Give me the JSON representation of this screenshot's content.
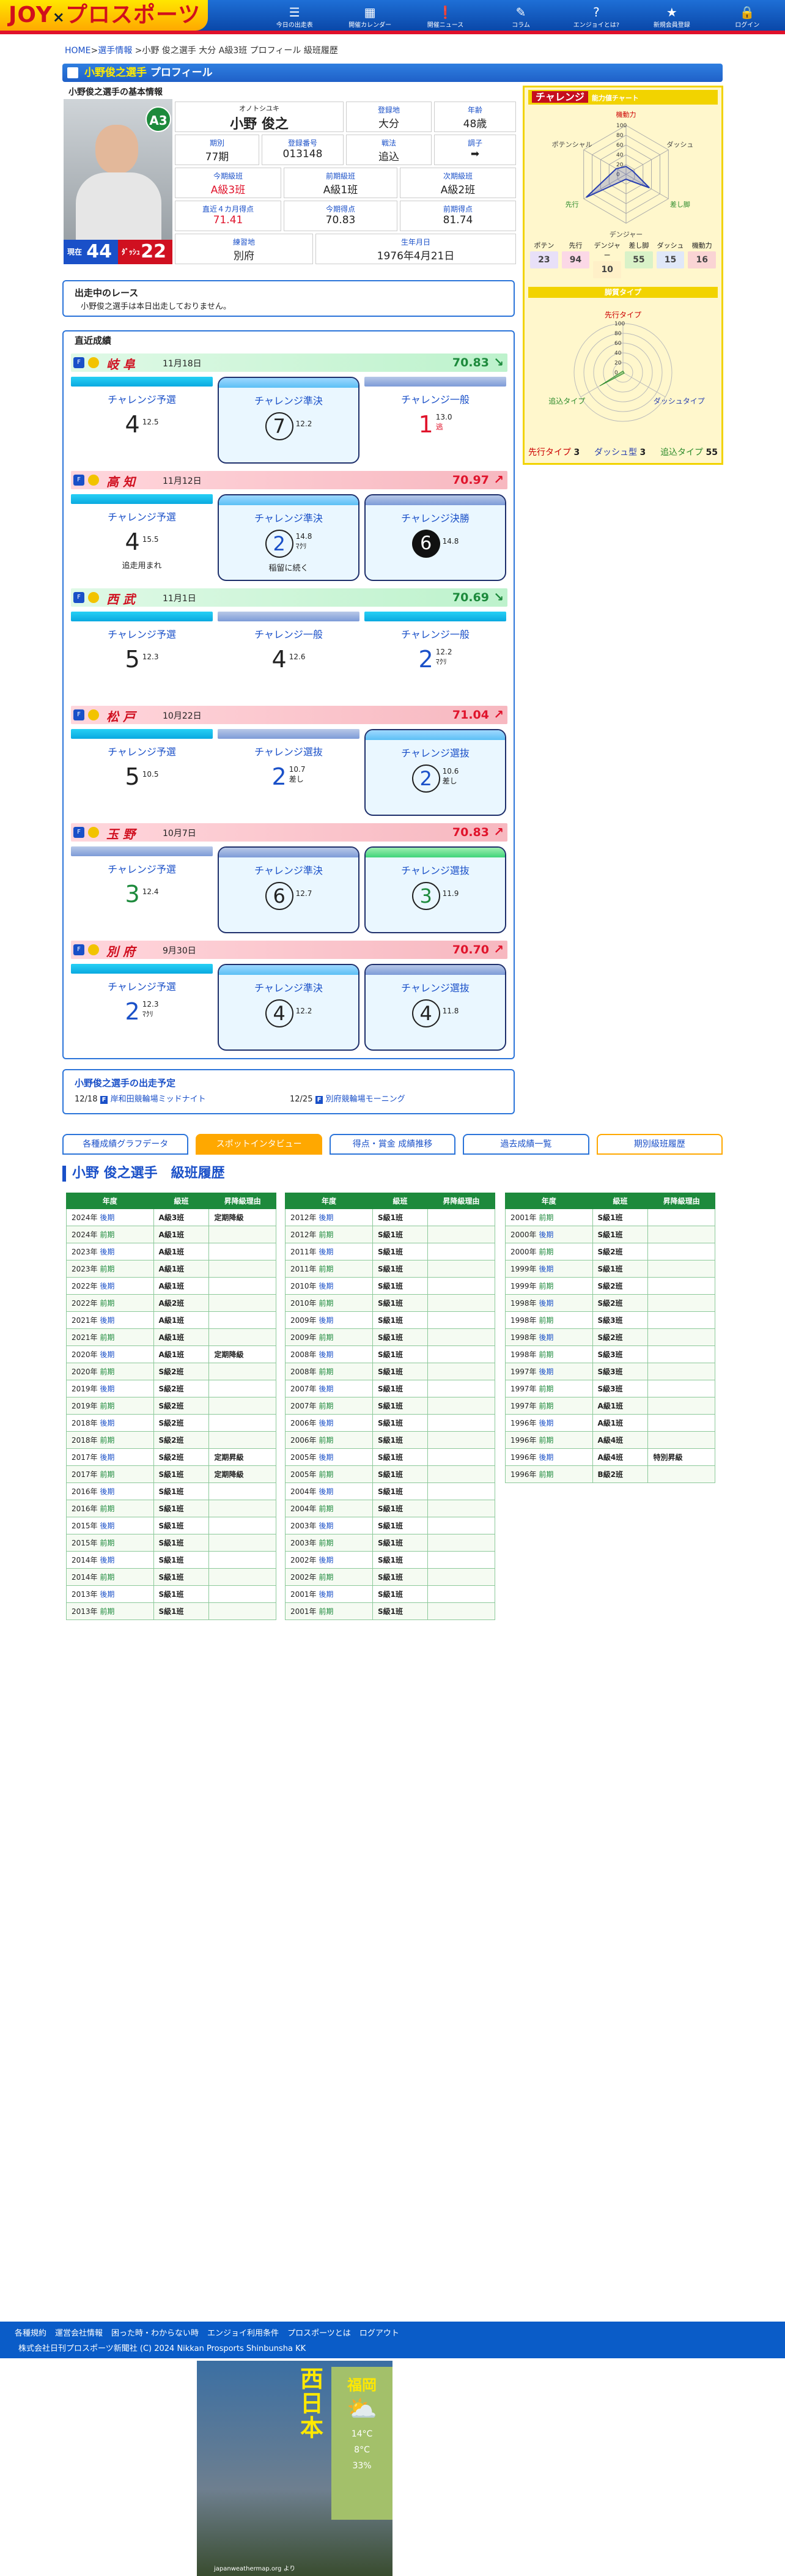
{
  "header": {
    "logo_a": "JOY",
    "logo_x": "×",
    "logo_b": "プロスポーツ",
    "nav": [
      {
        "icon": "newspaper-icon",
        "label": "今日の出走表",
        "g": "☰"
      },
      {
        "icon": "calendar-icon",
        "label": "開催カレンダー",
        "g": "▦"
      },
      {
        "icon": "alert-icon",
        "label": "開催ニュース",
        "g": "❗"
      },
      {
        "icon": "runner-icon",
        "label": "コラム",
        "g": "✎"
      },
      {
        "icon": "question-icon",
        "label": "エンジョイとは?",
        "g": "?"
      },
      {
        "icon": "member-icon",
        "label": "新規会員登録",
        "g": "★"
      },
      {
        "icon": "lock-icon",
        "label": "ログイン",
        "g": "🔒"
      }
    ]
  },
  "breadcrumb": {
    "home": "HOME",
    "sep": ">",
    "item": "選手情報",
    "rest": " >小野 俊之選手 大分 A級3班 プロフィール 級班履歴"
  },
  "title": {
    "name": "小野俊之選手",
    "suffix": "プロフィール"
  },
  "basic": {
    "heading": "小野俊之選手の基本情報",
    "rank_badge": "A3",
    "num1_label": "現在",
    "num1": "44",
    "num2_label": "ﾀﾞｯｼｭ",
    "num2": "22",
    "kana": "オノトシユキ",
    "name": "小野 俊之",
    "cells": [
      {
        "k": "登録地",
        "v": "大分"
      },
      {
        "k": "年齢",
        "v": "48歳"
      },
      {
        "k": "期別",
        "v": "77期"
      },
      {
        "k": "登録番号",
        "v": "013148"
      },
      {
        "k": "戦法",
        "v": "追込"
      },
      {
        "k": "調子",
        "v": "➡"
      },
      {
        "k": "今期級班",
        "v": "A級3班",
        "red": true
      },
      {
        "k": "前期級班",
        "v": "A級1班"
      },
      {
        "k": "次期級班",
        "v": "A級2班"
      },
      {
        "k": "直近４カ月得点",
        "v": "71.41",
        "red": true
      },
      {
        "k": "今期得点",
        "v": "70.83"
      },
      {
        "k": "前期得点",
        "v": "81.74"
      },
      {
        "k": "練習地",
        "v": "別府"
      },
      {
        "k": "生年月日",
        "v": "1976年4月21日"
      }
    ]
  },
  "challenge": {
    "tag": "チャレンジ",
    "label": "能力値チャート",
    "axes": [
      "機動力",
      "ダッシュ",
      "差し脚",
      "デンジャー",
      "先行",
      "ポテンシャル"
    ],
    "ticks": [
      "100",
      "80",
      "60",
      "40",
      "20",
      "0"
    ],
    "points": [
      {
        "k": "ポテン",
        "v": "23",
        "c": "#e8e0f8"
      },
      {
        "k": "先行",
        "v": "94",
        "c": "#fbd8e6"
      },
      {
        "k": "デンジャー",
        "v": "10",
        "c": "#fff0c8"
      },
      {
        "k": "差し脚",
        "v": "55",
        "c": "#d9f2c8"
      },
      {
        "k": "ダッシュ",
        "v": "15",
        "c": "#e0e8f8"
      },
      {
        "k": "機動力",
        "v": "16",
        "c": "#fad4d4"
      }
    ],
    "type_header": "脚質タイプ",
    "type_axes": [
      "先行タイプ",
      "ダッシュタイプ",
      "追込タイプ"
    ],
    "types": [
      {
        "label": "先行タイプ",
        "val": "3"
      },
      {
        "label": "ダッシュ型",
        "val": "3"
      },
      {
        "label": "追込タイプ",
        "val": "55"
      }
    ]
  },
  "race": {
    "title": "出走中のレース",
    "text": "小野俊之選手は本日出走しておりません。"
  },
  "recent": {
    "title": "直近成績",
    "rows": [
      {
        "c": "g",
        "venue": "岐 阜",
        "date": "11月18日",
        "score": "70.83",
        "arrow": "↘",
        "cards": [
          {
            "cap": "c1",
            "name": "チャレンジ予選",
            "pos": "4",
            "tm": "12.5"
          },
          {
            "cap": "c2",
            "name": "チャレンジ準決",
            "pos": "7",
            "tm": "12.2",
            "hl": true,
            "circ": true
          },
          {
            "cap": "c3",
            "name": "チャレンジ一般",
            "pos": "1",
            "tm": "13.0",
            "sub": "逃",
            "red": true
          }
        ]
      },
      {
        "c": "r",
        "venue": "高 知",
        "date": "11月12日",
        "score": "70.97",
        "arrow": "↗",
        "cards": [
          {
            "cap": "c1",
            "name": "チャレンジ予選",
            "pos": "4",
            "tm": "15.5",
            "note": "追走用まれ"
          },
          {
            "cap": "c2",
            "name": "チャレンジ準決",
            "pos": "2",
            "tm": "14.8",
            "sub": "ﾏｸﾘ",
            "note": "稲留に続く",
            "hl": true,
            "circ": true,
            "blue": true
          },
          {
            "cap": "c3",
            "name": "チャレンジ決勝",
            "pos": "6",
            "tm": "14.8",
            "hl": true,
            "blk": true
          }
        ]
      },
      {
        "c": "g",
        "venue": "西 武",
        "date": "11月1日",
        "score": "70.69",
        "arrow": "↘",
        "cards": [
          {
            "cap": "c1",
            "name": "チャレンジ予選",
            "pos": "5",
            "tm": "12.3"
          },
          {
            "cap": "c3",
            "name": "チャレンジ一般",
            "pos": "4",
            "tm": "12.6"
          },
          {
            "cap": "c1",
            "name": "チャレンジ一般",
            "pos": "2",
            "tm": "12.2",
            "sub": "ﾏｸﾘ",
            "blue": true
          }
        ]
      },
      {
        "c": "r",
        "venue": "松 戸",
        "date": "10月22日",
        "score": "71.04",
        "arrow": "↗",
        "cards": [
          {
            "cap": "c1",
            "name": "チャレンジ予選",
            "pos": "5",
            "tm": "10.5"
          },
          {
            "cap": "c3",
            "name": "チャレンジ選抜",
            "pos": "2",
            "tm": "10.7",
            "sub": "差し",
            "blue": true
          },
          {
            "cap": "c2",
            "name": "チャレンジ選抜",
            "pos": "2",
            "tm": "10.6",
            "sub": "差し",
            "hl": true,
            "circ": true,
            "blue": true
          }
        ]
      },
      {
        "c": "r",
        "venue": "玉 野",
        "date": "10月7日",
        "score": "70.83",
        "arrow": "↗",
        "cards": [
          {
            "cap": "c3",
            "name": "チャレンジ予選",
            "pos": "3",
            "tm": "12.4",
            "grn": true
          },
          {
            "cap": "c3",
            "name": "チャレンジ準決",
            "pos": "6",
            "tm": "12.7",
            "hl": true,
            "circ": true
          },
          {
            "cap": "c4",
            "name": "チャレンジ選抜",
            "pos": "3",
            "tm": "11.9",
            "hl": true,
            "circ": true,
            "grn": true
          }
        ]
      },
      {
        "c": "r",
        "venue": "別 府",
        "date": "9月30日",
        "score": "70.70",
        "arrow": "↗",
        "cards": [
          {
            "cap": "c1",
            "name": "チャレンジ予選",
            "pos": "2",
            "tm": "12.3",
            "sub": "ﾏｸﾘ",
            "blue": true
          },
          {
            "cap": "c2",
            "name": "チャレンジ準決",
            "pos": "4",
            "tm": "12.2",
            "hl": true,
            "circ": true
          },
          {
            "cap": "c3",
            "name": "チャレンジ選抜",
            "pos": "4",
            "tm": "11.8",
            "hl": true,
            "circ": true
          }
        ]
      }
    ]
  },
  "schedule": {
    "title": "小野俊之選手の出走予定",
    "e1_date": "12/18",
    "e1_text": "岸和田競輪場ミッドナイト",
    "e2_date": "12/25",
    "e2_text": "別府競輪場モーニング"
  },
  "tabs": [
    "各種成績グラフデータ",
    "スポットインタビュー",
    "得点・賞金 成績推移",
    "過去成績一覧",
    "期別級班履歴"
  ],
  "history": {
    "title": "小野 俊之選手　級班履歴",
    "cols": [
      "年度",
      "級班",
      "昇降級理由"
    ],
    "t1": [
      [
        "2024年",
        "後期",
        "A級3班",
        "定期降級"
      ],
      [
        "2024年",
        "前期",
        "A級1班",
        ""
      ],
      [
        "2023年",
        "後期",
        "A級1班",
        ""
      ],
      [
        "2023年",
        "前期",
        "A級1班",
        ""
      ],
      [
        "2022年",
        "後期",
        "A級1班",
        ""
      ],
      [
        "2022年",
        "前期",
        "A級2班",
        ""
      ],
      [
        "2021年",
        "後期",
        "A級1班",
        ""
      ],
      [
        "2021年",
        "前期",
        "A級1班",
        ""
      ],
      [
        "2020年",
        "後期",
        "A級1班",
        "定期降級"
      ],
      [
        "2020年",
        "前期",
        "S級2班",
        ""
      ],
      [
        "2019年",
        "後期",
        "S級2班",
        ""
      ],
      [
        "2019年",
        "前期",
        "S級2班",
        ""
      ],
      [
        "2018年",
        "後期",
        "S級2班",
        ""
      ],
      [
        "2018年",
        "前期",
        "S級2班",
        ""
      ],
      [
        "2017年",
        "後期",
        "S級2班",
        "定期昇級"
      ],
      [
        "2017年",
        "前期",
        "S級1班",
        "定期降級"
      ],
      [
        "2016年",
        "後期",
        "S級1班",
        ""
      ],
      [
        "2016年",
        "前期",
        "S級1班",
        ""
      ],
      [
        "2015年",
        "後期",
        "S級1班",
        ""
      ],
      [
        "2015年",
        "前期",
        "S級1班",
        ""
      ],
      [
        "2014年",
        "後期",
        "S級1班",
        ""
      ],
      [
        "2014年",
        "前期",
        "S級1班",
        ""
      ],
      [
        "2013年",
        "後期",
        "S級1班",
        ""
      ],
      [
        "2013年",
        "前期",
        "S級1班",
        ""
      ]
    ],
    "t2": [
      [
        "2012年",
        "後期",
        "S級1班",
        ""
      ],
      [
        "2012年",
        "前期",
        "S級1班",
        ""
      ],
      [
        "2011年",
        "後期",
        "S級1班",
        ""
      ],
      [
        "2011年",
        "前期",
        "S級1班",
        ""
      ],
      [
        "2010年",
        "後期",
        "S級1班",
        ""
      ],
      [
        "2010年",
        "前期",
        "S級1班",
        ""
      ],
      [
        "2009年",
        "後期",
        "S級1班",
        ""
      ],
      [
        "2009年",
        "前期",
        "S級1班",
        ""
      ],
      [
        "2008年",
        "後期",
        "S級1班",
        ""
      ],
      [
        "2008年",
        "前期",
        "S級1班",
        ""
      ],
      [
        "2007年",
        "後期",
        "S級1班",
        ""
      ],
      [
        "2007年",
        "前期",
        "S級1班",
        ""
      ],
      [
        "2006年",
        "後期",
        "S級1班",
        ""
      ],
      [
        "2006年",
        "前期",
        "S級1班",
        ""
      ],
      [
        "2005年",
        "後期",
        "S級1班",
        ""
      ],
      [
        "2005年",
        "前期",
        "S級1班",
        ""
      ],
      [
        "2004年",
        "後期",
        "S級1班",
        ""
      ],
      [
        "2004年",
        "前期",
        "S級1班",
        ""
      ],
      [
        "2003年",
        "後期",
        "S級1班",
        ""
      ],
      [
        "2003年",
        "前期",
        "S級1班",
        ""
      ],
      [
        "2002年",
        "後期",
        "S級1班",
        ""
      ],
      [
        "2002年",
        "前期",
        "S級1班",
        ""
      ],
      [
        "2001年",
        "後期",
        "S級1班",
        ""
      ],
      [
        "2001年",
        "前期",
        "S級1班",
        ""
      ]
    ],
    "t3": [
      [
        "2001年",
        "前期",
        "S級1班",
        ""
      ],
      [
        "2000年",
        "後期",
        "S級1班",
        ""
      ],
      [
        "2000年",
        "前期",
        "S級2班",
        ""
      ],
      [
        "1999年",
        "後期",
        "S級1班",
        ""
      ],
      [
        "1999年",
        "前期",
        "S級2班",
        ""
      ],
      [
        "1998年",
        "後期",
        "S級2班",
        ""
      ],
      [
        "1998年",
        "前期",
        "S級3班",
        ""
      ],
      [
        "1998年",
        "後期",
        "S級2班",
        ""
      ],
      [
        "1998年",
        "前期",
        "S級3班",
        ""
      ],
      [
        "1997年",
        "後期",
        "S級3班",
        ""
      ],
      [
        "1997年",
        "前期",
        "S級3班",
        ""
      ],
      [
        "1997年",
        "前期",
        "A級1班",
        ""
      ],
      [
        "1996年",
        "後期",
        "A級1班",
        ""
      ],
      [
        "1996年",
        "前期",
        "A級4班",
        ""
      ],
      [
        "1996年",
        "後期",
        "A級4班",
        "特別昇級"
      ],
      [
        "1996年",
        "前期",
        "B級2班",
        ""
      ]
    ]
  },
  "footer": {
    "links": [
      "各種規約",
      "運営会社情報",
      "困った時・わからない時",
      "エンジョイ利用条件",
      "プロスポーツとは",
      "ログアウト"
    ],
    "copy": "株式会社日刊プロスポーツ新聞社 (C) 2024 Nikkan Prosports Shinbunsha KK"
  },
  "ad": {
    "title": "西日本",
    "city": "福岡",
    "t1": "14°C",
    "t2": "8°C",
    "t3": "33%",
    "src": "japanweathermap.org より"
  }
}
